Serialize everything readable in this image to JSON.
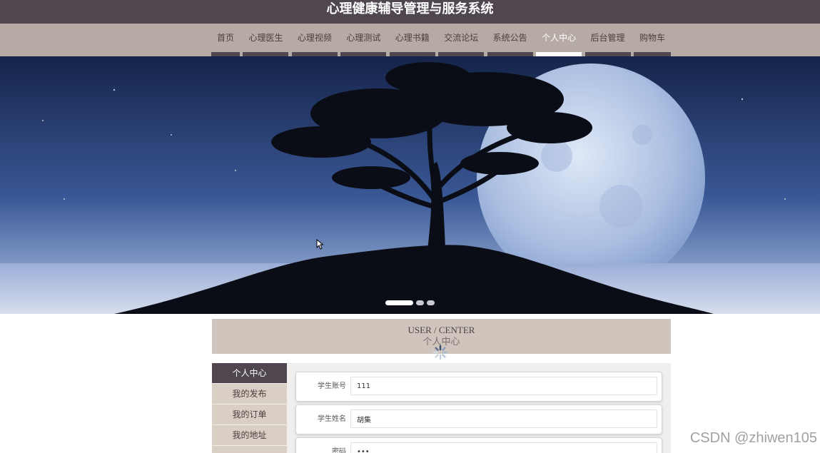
{
  "app": {
    "title": "心理健康辅导管理与服务系统"
  },
  "nav": {
    "items": [
      {
        "label": "首页",
        "icon": "",
        "active": false
      },
      {
        "label": "心理医生",
        "active": false
      },
      {
        "label": "心理视频",
        "active": false
      },
      {
        "label": "心理测试",
        "active": false
      },
      {
        "label": "心理书籍",
        "active": false
      },
      {
        "label": "交流论坛",
        "active": false
      },
      {
        "label": "系统公告",
        "active": false
      },
      {
        "label": "个人中心",
        "active": true
      },
      {
        "label": "后台管理",
        "active": false
      },
      {
        "label": "购物车",
        "active": false
      }
    ]
  },
  "banner": {
    "slide_count": 3,
    "active_slide": 1
  },
  "section": {
    "title_en": "USER / CENTER",
    "title_zh": "个人中心"
  },
  "side_menu": {
    "items": [
      {
        "label": "个人中心",
        "active": true
      },
      {
        "label": "我的发布",
        "active": false
      },
      {
        "label": "我的订单",
        "active": false
      },
      {
        "label": "我的地址",
        "active": false
      }
    ]
  },
  "form": {
    "fields": [
      {
        "label": "学生账号",
        "value": "111"
      },
      {
        "label": "学生姓名",
        "value": "胡集"
      },
      {
        "label": "密码",
        "value": "•••"
      }
    ]
  },
  "watermark": {
    "text": "CSDN @zhiwen105"
  },
  "colors": {
    "header": "#4f4650",
    "nav": "#b6aaa4",
    "section": "#cfc5bd",
    "side": "#d9cfc5"
  }
}
